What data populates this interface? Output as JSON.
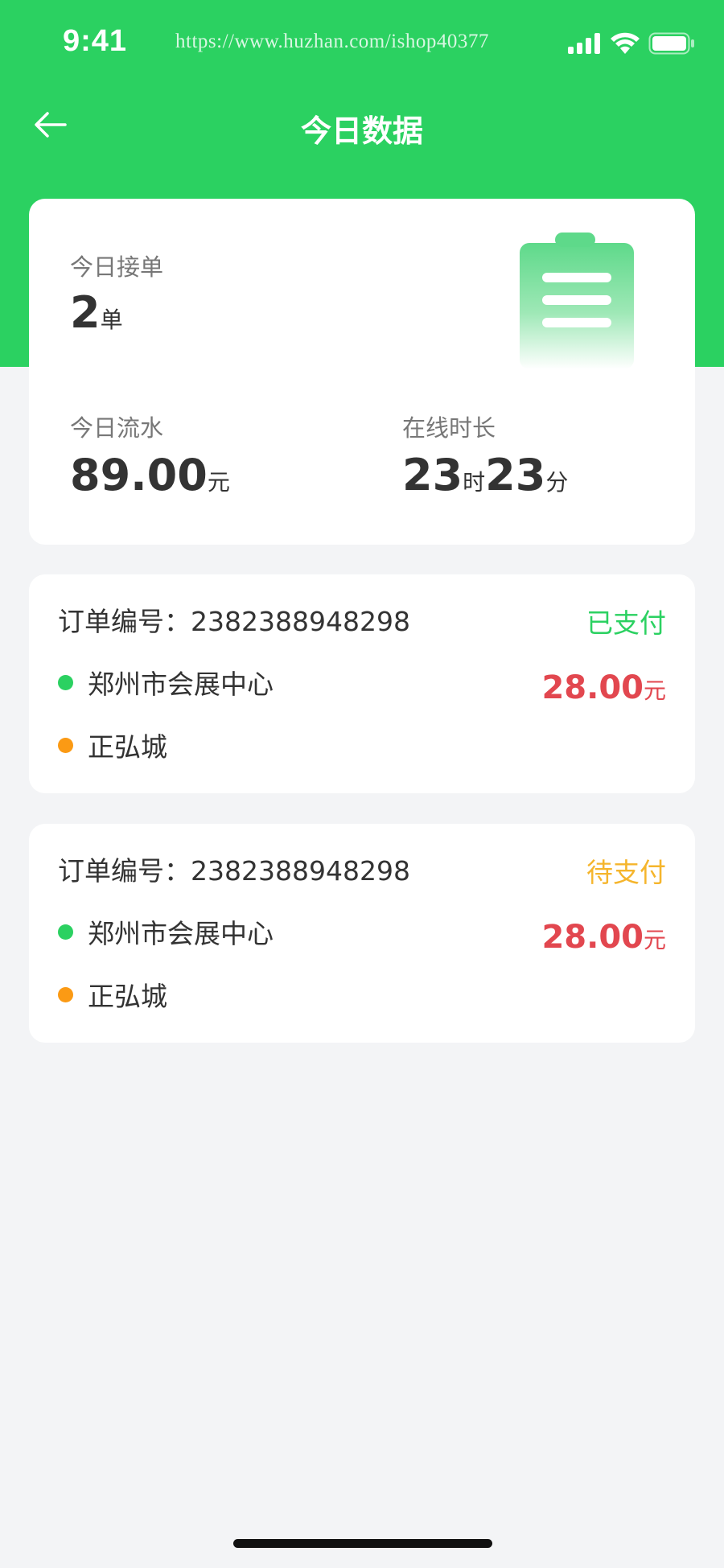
{
  "status_bar": {
    "time": "9:41",
    "url": "https://www.huzhan.com/ishop40377",
    "icons": [
      "signal-icon",
      "wifi-icon",
      "battery-icon"
    ]
  },
  "nav": {
    "title": "今日数据",
    "back_icon": "arrow-left-icon"
  },
  "summary": {
    "orders_label": "今日接单",
    "orders_value": "2",
    "orders_unit": "单",
    "income_label": "今日流水",
    "income_value": "89.00",
    "income_unit": "元",
    "online_label": "在线时长",
    "online_hours": "23",
    "online_hours_unit": "时",
    "online_minutes": "23",
    "online_minutes_unit": "分",
    "icon": "clipboard-icon"
  },
  "orders": [
    {
      "number_label": "订单编号：",
      "number": "2382388948298",
      "status": "已支付",
      "status_color": "#2bd161",
      "from": "郑州市会展中心",
      "to": "正弘城",
      "price": "28.00",
      "price_unit": "元"
    },
    {
      "number_label": "订单编号：",
      "number": "2382388948298",
      "status": "待支付",
      "status_color": "#f5b52c",
      "from": "郑州市会展中心",
      "to": "正弘城",
      "price": "28.00",
      "price_unit": "元"
    }
  ],
  "colors": {
    "brand_green": "#2bd161",
    "price_red": "#e2474f",
    "from_dot": "#2bd161",
    "to_dot": "#fb9a14",
    "pending_yellow": "#f5b52c"
  }
}
